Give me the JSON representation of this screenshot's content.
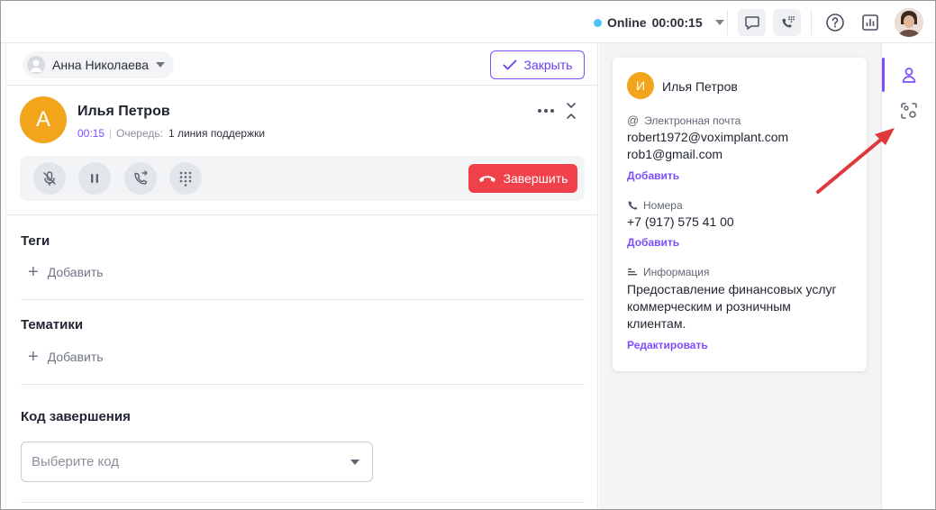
{
  "colors": {
    "accent": "#7c4dff",
    "online": "#4fc3f7",
    "avatar_orange": "#f2a51a",
    "danger": "#f0414a",
    "annotation_arrow": "#e0393b"
  },
  "topbar": {
    "status_label": "Online",
    "status_timer": "00:00:15",
    "icons": [
      "chat-icon",
      "dialpad-call-icon",
      "help-icon",
      "analytics-icon"
    ]
  },
  "agent": {
    "name": "Анна Николаева"
  },
  "close_button": {
    "label": "Закрыть"
  },
  "call": {
    "avatar_initial": "А",
    "caller_name": "Илья Петров",
    "time": "00:15",
    "queue_label": "Очередь:",
    "queue_value": "1 линия поддержки",
    "end_label": "Завершить"
  },
  "sections": {
    "tags": {
      "title": "Теги",
      "add_label": "Добавить"
    },
    "topics": {
      "title": "Тематики",
      "add_label": "Добавить"
    },
    "completion": {
      "title": "Код завершения",
      "placeholder": "Выберите код"
    }
  },
  "contact_card": {
    "avatar_initial": "И",
    "name": "Илья Петров",
    "email_label": "Электронная почта",
    "emails": [
      "robert1972@voximplant.com",
      "rob1@gmail.com"
    ],
    "email_add": "Добавить",
    "phone_label": "Номера",
    "phones": [
      "+7 (917) 575 41 00"
    ],
    "phone_add": "Добавить",
    "info_label": "Информация",
    "info_lines": [
      "Предоставление финансовых услуг",
      "коммерческим и розничным",
      "клиентам."
    ],
    "info_edit": "Редактировать"
  }
}
